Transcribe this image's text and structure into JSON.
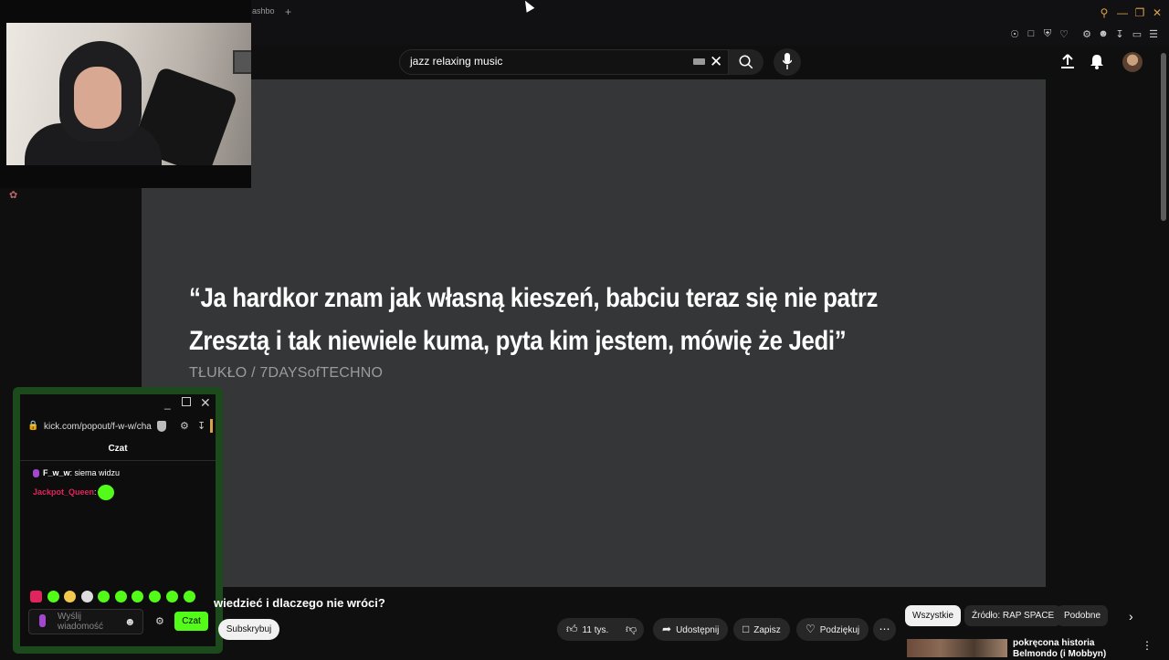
{
  "browser": {
    "tab_fragment": "ashbo",
    "new_tab": "+"
  },
  "youtube": {
    "search_query": "jazz relaxing music",
    "lyric_line1": "“Ja hardkor znam jak własną kieszeń, babciu teraz się nie patrz",
    "lyric_line2": "Zresztą i tak niewiele kuma, pyta kim jestem, mówię że Jedi”",
    "credit": "TŁUKŁO / 7DAYSofTECHNO",
    "video_title": "wiedzieć i dlaczego nie wróci?",
    "subscribe_label": "Subskrybuj",
    "actions": {
      "likes": "11 tys.",
      "share": "Udostępnij",
      "save": "Zapisz",
      "thanks": "Podziękuj"
    },
    "chips": [
      "Wszystkie",
      "Źródło: RAP SPACE",
      "Podobne"
    ],
    "recommended_title": "pokręcona historia Belmondo (i Mobbyn)"
  },
  "kick_popout": {
    "url": "kick.com/popout/f-w-w/chat",
    "title": "Czat",
    "messages": [
      {
        "user": "F_w_w",
        "text": "siema widzu"
      },
      {
        "user": "Jackpot_Queen",
        "text": ""
      }
    ],
    "input_placeholder": "Wyślij wiadomość",
    "send_label": "Czat"
  },
  "colors": {
    "kick_green": "#53fc18",
    "kick_border": "#1c4a1c",
    "video_bg": "#353637",
    "accent_orange": "#d8a24a"
  }
}
